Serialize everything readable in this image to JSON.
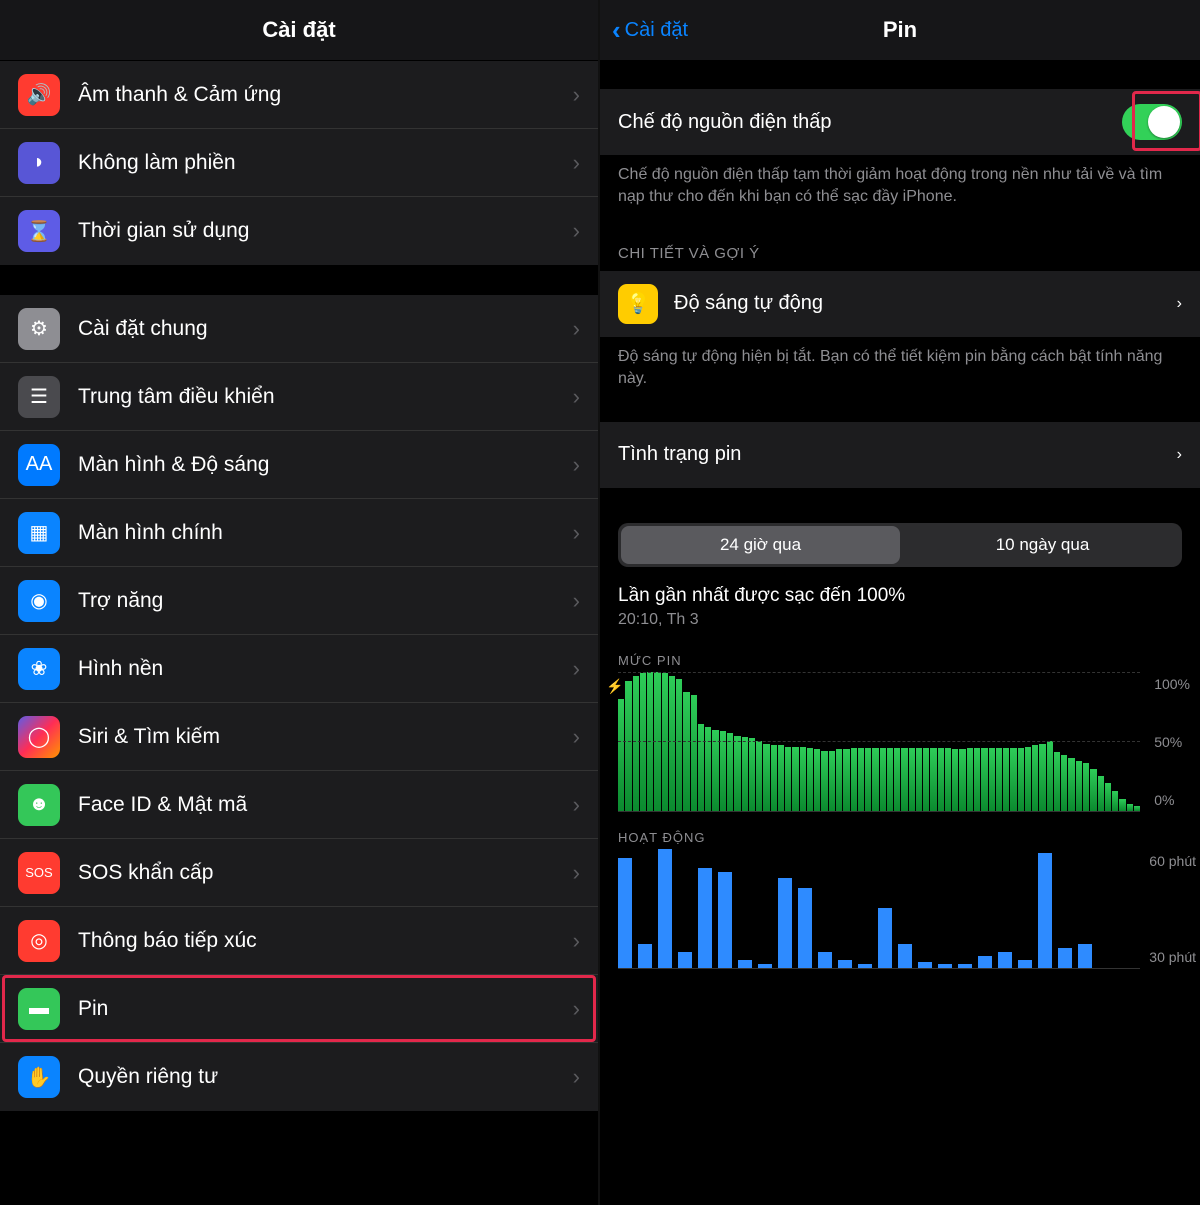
{
  "left": {
    "title": "Cài đặt",
    "items": [
      {
        "id": "sound",
        "label": "Âm thanh & Cảm ứng",
        "iconClass": "ic-red",
        "iconName": "sound-icon",
        "glyph": "🔊"
      },
      {
        "id": "dnd",
        "label": "Không làm phiền",
        "iconClass": "ic-purple",
        "iconName": "moon-icon",
        "glyph": "◗"
      },
      {
        "id": "screentime",
        "label": "Thời gian sử dụng",
        "iconClass": "ic-indigo",
        "iconName": "hourglass-icon",
        "glyph": "⌛"
      }
    ],
    "items2": [
      {
        "id": "general",
        "label": "Cài đặt chung",
        "iconClass": "ic-gray",
        "iconName": "gear-icon",
        "glyph": "⚙"
      },
      {
        "id": "controlcenter",
        "label": "Trung tâm điều khiển",
        "iconClass": "ic-darkgray",
        "iconName": "switches-icon",
        "glyph": "☰"
      },
      {
        "id": "display",
        "label": "Màn hình & Độ sáng",
        "iconClass": "ic-blue",
        "iconName": "text-size-icon",
        "glyph": "AA"
      },
      {
        "id": "home",
        "label": "Màn hình chính",
        "iconClass": "ic-blueapp",
        "iconName": "grid-icon",
        "glyph": "▦"
      },
      {
        "id": "accessibility",
        "label": "Trợ năng",
        "iconClass": "ic-teal",
        "iconName": "accessibility-icon",
        "glyph": "◉"
      },
      {
        "id": "wallpaper",
        "label": "Hình nền",
        "iconClass": "ic-teal",
        "iconName": "wallpaper-icon",
        "glyph": "❀"
      },
      {
        "id": "siri",
        "label": "Siri & Tìm kiếm",
        "iconClass": "ic-siri",
        "iconName": "siri-icon",
        "glyph": "◯"
      },
      {
        "id": "faceid",
        "label": "Face ID & Mật mã",
        "iconClass": "ic-green",
        "iconName": "faceid-icon",
        "glyph": "☻"
      },
      {
        "id": "sos",
        "label": "SOS khẩn cấp",
        "iconClass": "ic-sos",
        "iconName": "sos-icon",
        "glyph": "SOS"
      },
      {
        "id": "exposure",
        "label": "Thông báo tiếp xúc",
        "iconClass": "ic-exposure",
        "iconName": "exposure-icon",
        "glyph": "◎"
      },
      {
        "id": "battery",
        "label": "Pin",
        "iconClass": "ic-green",
        "iconName": "battery-icon",
        "glyph": "▬"
      },
      {
        "id": "privacy",
        "label": "Quyền riêng tư",
        "iconClass": "ic-privacy",
        "iconName": "hand-icon",
        "glyph": "✋"
      }
    ],
    "highlight_id": "battery"
  },
  "right": {
    "back": "Cài đặt",
    "title": "Pin",
    "lowpower": {
      "label": "Chế độ nguồn điện thấp",
      "on": true,
      "desc": "Chế độ nguồn điện thấp tạm thời giảm hoạt động trong nền như tải về và tìm nạp thư cho đến khi bạn có thể sạc đầy iPhone."
    },
    "insights": {
      "header": "CHI TIẾT VÀ GỢI Ý",
      "item_label": "Độ sáng tự động",
      "item_desc": "Độ sáng tự động hiện bị tắt. Bạn có thể tiết kiệm pin bằng cách bật tính năng này."
    },
    "health_label": "Tình trạng pin",
    "segmented": {
      "a": "24 giờ qua",
      "b": "10 ngày qua",
      "active": "a"
    },
    "last_charge": {
      "line1": "Lần gần nhất được sạc đến 100%",
      "line2": "20:10, Th 3"
    },
    "level_chart": {
      "header": "MỨC PIN",
      "ticks": [
        "100%",
        "50%",
        "0%"
      ]
    },
    "activity_chart": {
      "header": "HOẠT ĐỘNG",
      "ticks": [
        "60 phút",
        "30 phút"
      ]
    }
  },
  "chart_data": [
    {
      "type": "bar",
      "title": "MỨC PIN",
      "ylabel": "percent",
      "ylim": [
        0,
        100
      ],
      "x": "hourly buckets, last 24h",
      "values": [
        80,
        93,
        97,
        99,
        100,
        100,
        99,
        97,
        95,
        85,
        83,
        62,
        60,
        58,
        57,
        56,
        54,
        53,
        52,
        50,
        48,
        47,
        47,
        46,
        46,
        46,
        45,
        44,
        43,
        43,
        44,
        44,
        45,
        45,
        45,
        45,
        45,
        45,
        45,
        45,
        45,
        45,
        45,
        45,
        45,
        45,
        44,
        44,
        45,
        45,
        45,
        45,
        45,
        45,
        45,
        45,
        46,
        47,
        48,
        50,
        42,
        40,
        38,
        36,
        34,
        30,
        25,
        20,
        14,
        8,
        5,
        3
      ]
    },
    {
      "type": "bar",
      "title": "HOẠT ĐỘNG",
      "ylabel": "minutes",
      "ylim": [
        0,
        60
      ],
      "x": "hourly buckets, last 24h",
      "values": [
        55,
        12,
        60,
        8,
        50,
        48,
        4,
        2,
        45,
        40,
        8,
        4,
        2,
        30,
        12,
        3,
        2,
        2,
        6,
        8,
        4,
        58,
        10,
        12
      ]
    }
  ]
}
